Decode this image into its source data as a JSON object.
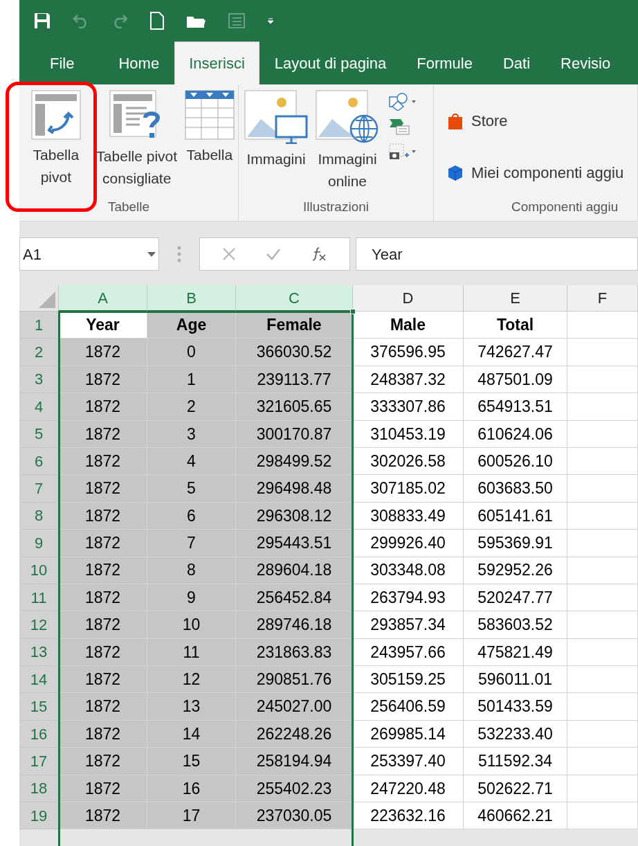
{
  "ribbon_tabs": [
    {
      "label": "File",
      "selected": false
    },
    {
      "label": "Home",
      "selected": false
    },
    {
      "label": "Inserisci",
      "selected": true
    },
    {
      "label": "Layout di pagina",
      "selected": false
    },
    {
      "label": "Formule",
      "selected": false
    },
    {
      "label": "Dati",
      "selected": false
    },
    {
      "label": "Revisio",
      "selected": false
    }
  ],
  "ribbon_groups": [
    {
      "label": "Tabelle",
      "buttons": [
        {
          "kind": "pivot",
          "label": "Tabella pivot",
          "highlighted": true
        },
        {
          "kind": "recommended_pivot",
          "label": "Tabelle pivot consigliate"
        },
        {
          "kind": "table",
          "label": "Tabella"
        }
      ]
    },
    {
      "label": "Illustrazioni",
      "buttons": [
        {
          "kind": "pictures",
          "label": "Immagini"
        },
        {
          "kind": "online_pictures",
          "label": "Immagini online"
        },
        {
          "kind": "small_stack"
        }
      ]
    },
    {
      "label": "Componenti aggiu",
      "buttons": [
        {
          "kind": "addin_list",
          "items": [
            "Store",
            "Miei componenti aggiu"
          ]
        }
      ]
    }
  ],
  "name_box": "A1",
  "formula": "Year",
  "columns": [
    {
      "label": "A",
      "selected": true
    },
    {
      "label": "B",
      "selected": true
    },
    {
      "label": "C",
      "selected": true
    },
    {
      "label": "D",
      "selected": false
    },
    {
      "label": "E",
      "selected": false
    },
    {
      "label": "F",
      "selected": false
    }
  ],
  "rows": [
    {
      "number": "1",
      "kind": "header",
      "selected": true,
      "has_active_cell": true,
      "cells": [
        "Year",
        "Age",
        "Female",
        "Male",
        "Total"
      ]
    },
    {
      "number": "2",
      "kind": "data",
      "selected": true,
      "has_active_cell": false,
      "cells": [
        "1872",
        "0",
        "366030.52",
        "376596.95",
        "742627.47"
      ]
    },
    {
      "number": "3",
      "kind": "data",
      "selected": true,
      "has_active_cell": false,
      "cells": [
        "1872",
        "1",
        "239113.77",
        "248387.32",
        "487501.09"
      ]
    },
    {
      "number": "4",
      "kind": "data",
      "selected": true,
      "has_active_cell": false,
      "cells": [
        "1872",
        "2",
        "321605.65",
        "333307.86",
        "654913.51"
      ]
    },
    {
      "number": "5",
      "kind": "data",
      "selected": true,
      "has_active_cell": false,
      "cells": [
        "1872",
        "3",
        "300170.87",
        "310453.19",
        "610624.06"
      ]
    },
    {
      "number": "6",
      "kind": "data",
      "selected": true,
      "has_active_cell": false,
      "cells": [
        "1872",
        "4",
        "298499.52",
        "302026.58",
        "600526.10"
      ]
    },
    {
      "number": "7",
      "kind": "data",
      "selected": true,
      "has_active_cell": false,
      "cells": [
        "1872",
        "5",
        "296498.48",
        "307185.02",
        "603683.50"
      ]
    },
    {
      "number": "8",
      "kind": "data",
      "selected": true,
      "has_active_cell": false,
      "cells": [
        "1872",
        "6",
        "296308.12",
        "308833.49",
        "605141.61"
      ]
    },
    {
      "number": "9",
      "kind": "data",
      "selected": true,
      "has_active_cell": false,
      "cells": [
        "1872",
        "7",
        "295443.51",
        "299926.40",
        "595369.91"
      ]
    },
    {
      "number": "10",
      "kind": "data",
      "selected": true,
      "has_active_cell": false,
      "cells": [
        "1872",
        "8",
        "289604.18",
        "303348.08",
        "592952.26"
      ]
    },
    {
      "number": "11",
      "kind": "data",
      "selected": true,
      "has_active_cell": false,
      "cells": [
        "1872",
        "9",
        "256452.84",
        "263794.93",
        "520247.77"
      ]
    },
    {
      "number": "12",
      "kind": "data",
      "selected": true,
      "has_active_cell": false,
      "cells": [
        "1872",
        "10",
        "289746.18",
        "293857.34",
        "583603.52"
      ]
    },
    {
      "number": "13",
      "kind": "data",
      "selected": true,
      "has_active_cell": false,
      "cells": [
        "1872",
        "11",
        "231863.83",
        "243957.66",
        "475821.49"
      ]
    },
    {
      "number": "14",
      "kind": "data",
      "selected": true,
      "has_active_cell": false,
      "cells": [
        "1872",
        "12",
        "290851.76",
        "305159.25",
        "596011.01"
      ]
    },
    {
      "number": "15",
      "kind": "data",
      "selected": true,
      "has_active_cell": false,
      "cells": [
        "1872",
        "13",
        "245027.00",
        "256406.59",
        "501433.59"
      ]
    },
    {
      "number": "16",
      "kind": "data",
      "selected": true,
      "has_active_cell": false,
      "cells": [
        "1872",
        "14",
        "262248.26",
        "269985.14",
        "532233.40"
      ]
    },
    {
      "number": "17",
      "kind": "data",
      "selected": true,
      "has_active_cell": false,
      "cells": [
        "1872",
        "15",
        "258194.94",
        "253397.40",
        "511592.34"
      ]
    },
    {
      "number": "18",
      "kind": "data",
      "selected": true,
      "has_active_cell": false,
      "cells": [
        "1872",
        "16",
        "255402.23",
        "247220.48",
        "502622.71"
      ]
    },
    {
      "number": "19",
      "kind": "data",
      "selected": true,
      "has_active_cell": false,
      "cells": [
        "1872",
        "17",
        "237030.05",
        "223632.16",
        "460662.21"
      ]
    }
  ]
}
